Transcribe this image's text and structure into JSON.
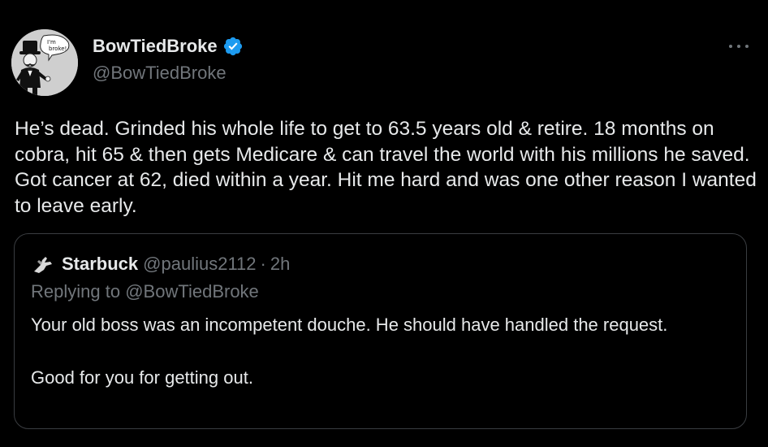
{
  "author": {
    "name": "BowTiedBroke",
    "handle": "@BowTiedBroke",
    "avatar_caption": "I'm broke!",
    "verified_color": "#1d9bf0"
  },
  "tweet": {
    "text": "He’s dead. Grinded his whole life to get to 63.5 years old & retire. 18 months on cobra, hit 65 & then gets Medicare & can travel the world with his millions he saved. Got cancer at 62, died within a year. Hit me hard and was one other reason I wanted to leave early."
  },
  "quoted_tweet": {
    "name": "Starbuck",
    "handle": "@paulius2112",
    "separator": "·",
    "time": "2h",
    "replying_prefix": "Replying to",
    "replying_handle": "@BowTiedBroke",
    "paragraph_1": "Your old boss was an incompetent douche. He should have handled the request.",
    "paragraph_2": "Good for you for getting out."
  },
  "icons": {
    "more": "more-horizontal-icon",
    "verified": "verified-badge-icon"
  },
  "colors": {
    "background": "#000000",
    "text_primary": "#e7e9ea",
    "text_secondary": "#71767b",
    "border": "#3a3d41",
    "verified": "#1d9bf0"
  }
}
